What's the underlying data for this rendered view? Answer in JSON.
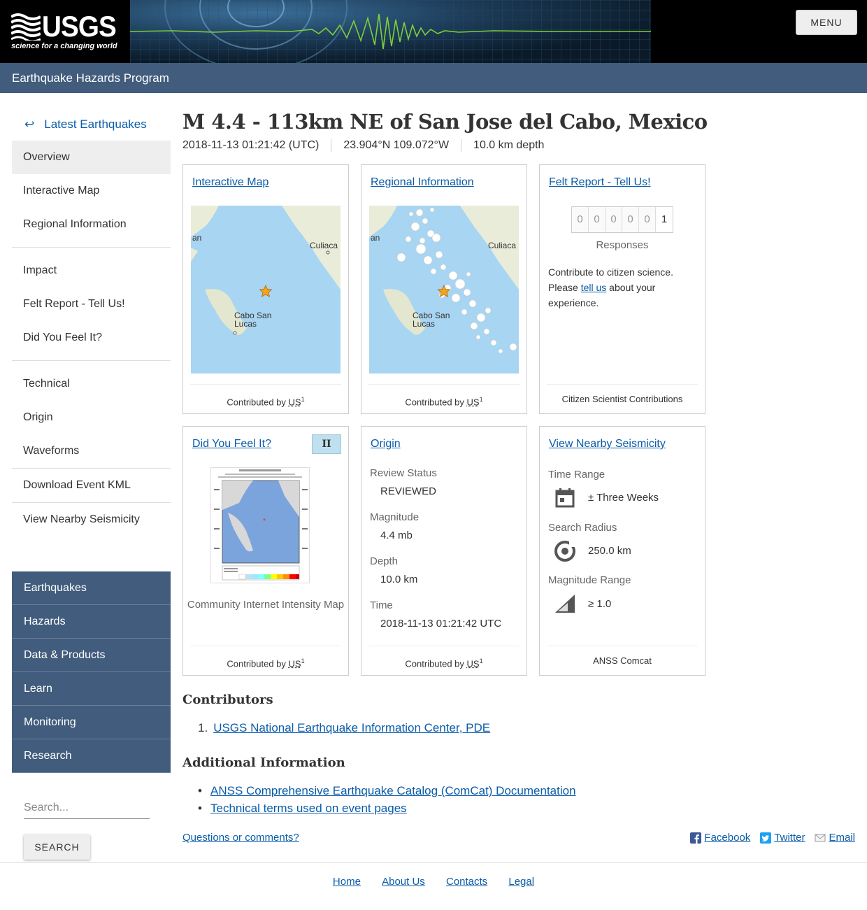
{
  "header": {
    "logo_text": "USGS",
    "logo_tagline": "science for a changing world",
    "menu_label": "MENU",
    "program_title": "Earthquake Hazards Program"
  },
  "sidebar": {
    "back_label": "Latest Earthquakes",
    "items": [
      {
        "label": "Overview"
      },
      {
        "label": "Interactive Map"
      },
      {
        "label": "Regional Information"
      },
      {
        "label": "Impact"
      },
      {
        "label": "Felt Report - Tell Us!"
      },
      {
        "label": "Did You Feel It?"
      },
      {
        "label": "Technical"
      },
      {
        "label": "Origin"
      },
      {
        "label": "Waveforms"
      },
      {
        "label": "Download Event KML"
      },
      {
        "label": "View Nearby Seismicity"
      }
    ],
    "site_nav": [
      "Earthquakes",
      "Hazards",
      "Data & Products",
      "Learn",
      "Monitoring",
      "Research"
    ],
    "search_placeholder": "Search...",
    "search_button": "SEARCH"
  },
  "event": {
    "title": "M 4.4 - 113km NE of San Jose del Cabo, Mexico",
    "time": "2018-11-13 01:21:42 (UTC)",
    "location": "23.904°N 109.072°W",
    "depth": "10.0 km depth"
  },
  "cards": {
    "contributed_prefix": "Contributed by",
    "contributor_abbr": "US",
    "contributor_sup": "1",
    "map": {
      "title": "Interactive Map",
      "label_culiacan": "Culiaca",
      "label_cabo": "Cabo San",
      "label_lucas": "Lucas",
      "label_edge": "an"
    },
    "regional": {
      "title": "Regional Information"
    },
    "felt": {
      "title": "Felt Report - Tell Us!",
      "digits": [
        "0",
        "0",
        "0",
        "0",
        "0",
        "1"
      ],
      "responses_label": "Responses",
      "text_before": "Contribute to citizen science. Please",
      "text_link": "tell us",
      "text_after": "about your experience.",
      "footer": "Citizen Scientist Contributions"
    },
    "dyfi": {
      "title": "Did You Feel It?",
      "mmi": "II",
      "caption": "Community Internet Intensity Map"
    },
    "origin": {
      "title": "Origin",
      "review_label": "Review Status",
      "review_value": "REVIEWED",
      "magnitude_label": "Magnitude",
      "magnitude_value": "4.4 mb",
      "depth_label": "Depth",
      "depth_value": "10.0 km",
      "time_label": "Time",
      "time_value": "2018-11-13 01:21:42 UTC"
    },
    "seismicity": {
      "title": "View Nearby Seismicity",
      "time_range_label": "Time Range",
      "time_range_value": "± Three Weeks",
      "radius_label": "Search Radius",
      "radius_value": "250.0 km",
      "magnitude_label": "Magnitude Range",
      "magnitude_value": "≥ 1.0",
      "footer": "ANSS Comcat"
    }
  },
  "contributors": {
    "heading": "Contributors",
    "items": [
      {
        "num": "1.",
        "label": "USGS National Earthquake Information Center, PDE"
      }
    ]
  },
  "additional_info": {
    "heading": "Additional Information",
    "items": [
      "ANSS Comprehensive Earthquake Catalog (ComCat) Documentation",
      "Technical terms used on event pages"
    ]
  },
  "questions_link": "Questions or comments?",
  "share": {
    "facebook": "Facebook",
    "twitter": "Twitter",
    "email": "Email"
  },
  "footer": {
    "links": [
      "Home",
      "About Us",
      "Contacts",
      "Legal"
    ]
  },
  "colors": {
    "nav_blue": "#415c7c",
    "link": "#0b5ca8",
    "map_water": "#a8d5f2",
    "mmi_badge": "#bfe0ee"
  }
}
